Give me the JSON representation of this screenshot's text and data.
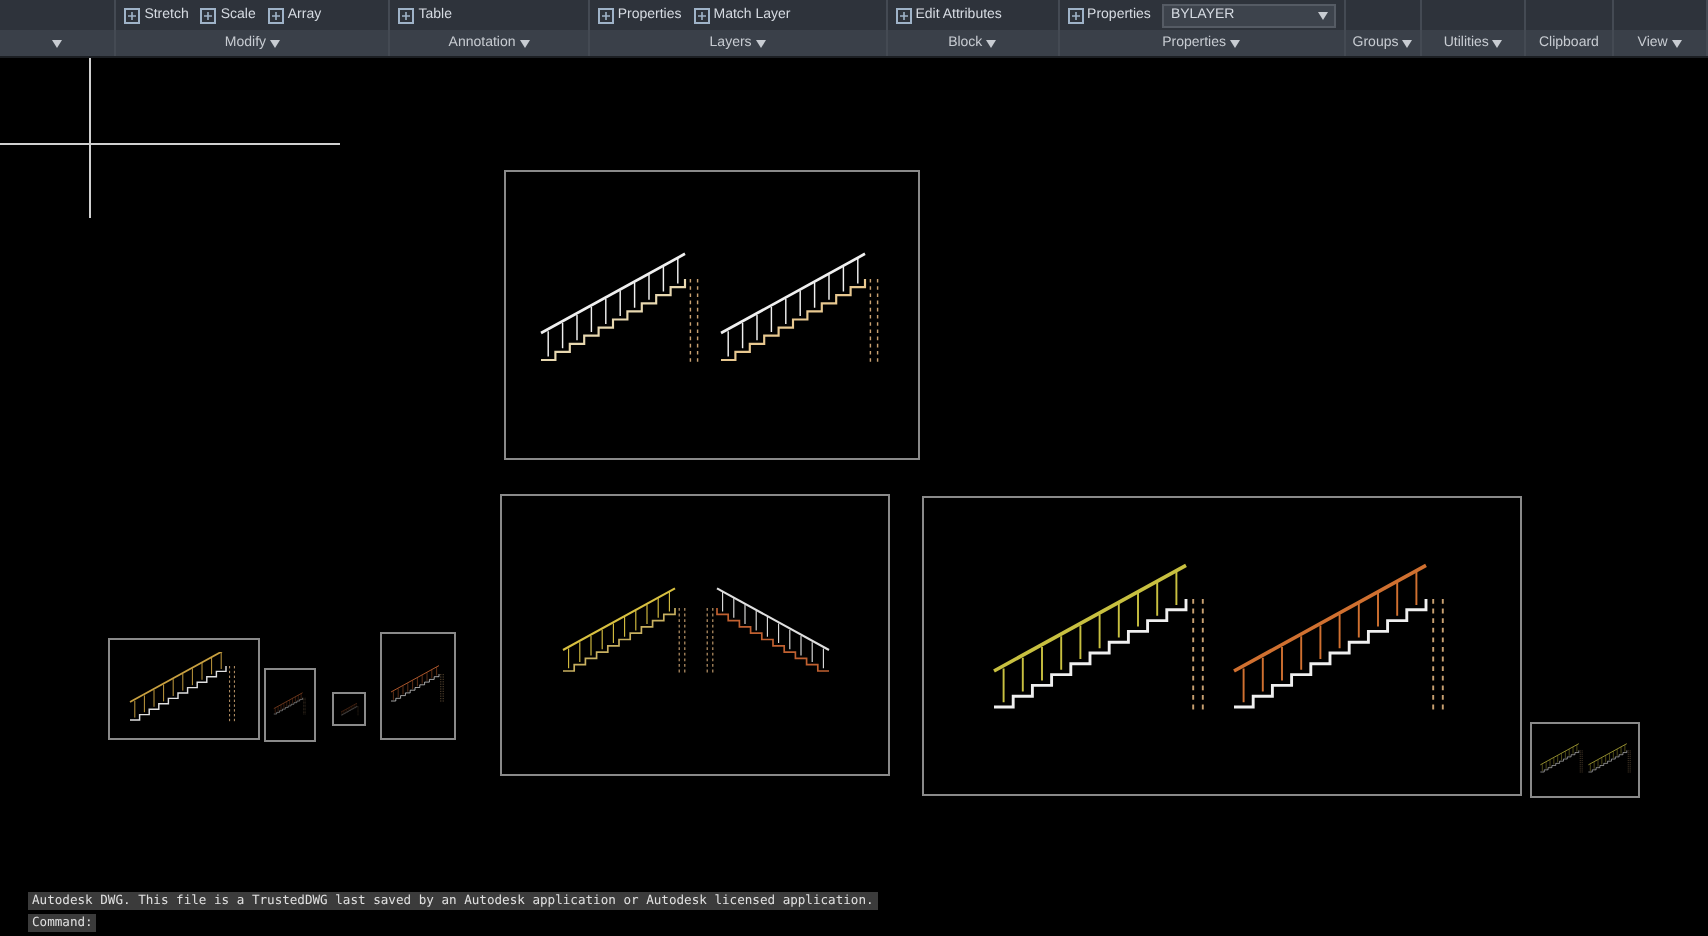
{
  "ribbon": {
    "panels": [
      {
        "menu": true
      },
      {
        "label": "Modify",
        "menu": true,
        "tools": [
          {
            "label": "Stretch"
          },
          {
            "label": "Scale"
          },
          {
            "label": "Array"
          }
        ]
      },
      {
        "label": "Annotation",
        "menu": true,
        "tools": [
          {
            "label": "Table"
          }
        ]
      },
      {
        "label": "Layers",
        "menu": true,
        "tools": [
          {
            "label": "Properties"
          },
          {
            "label": "Match Layer"
          }
        ]
      },
      {
        "label": "Block",
        "menu": true,
        "tools": [
          {
            "label": "Edit Attributes"
          }
        ]
      },
      {
        "label": "Properties",
        "menu": true,
        "tools": [
          {
            "label": "Properties"
          }
        ],
        "dropdown": {
          "value": "BYLAYER"
        }
      },
      {
        "label": "Groups",
        "menu": true
      },
      {
        "label": "Utilities",
        "menu": true
      },
      {
        "label": "Clipboard",
        "menu": false
      },
      {
        "label": "View",
        "menu": true
      }
    ]
  },
  "command_line": {
    "history": "Autodesk DWG.  This file is a TrustedDWG last saved by an Autodesk application or Autodesk licensed application.",
    "prompt": "Command:"
  }
}
